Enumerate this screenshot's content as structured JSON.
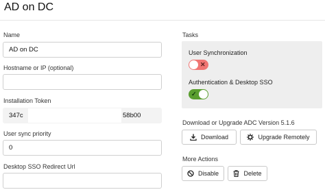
{
  "header": {
    "title": "AD on DC"
  },
  "form": {
    "name": {
      "label": "Name",
      "value": "AD on DC"
    },
    "hostname": {
      "label": "Hostname or IP (optional)",
      "value": ""
    },
    "token": {
      "label": "Installation Token",
      "value_start": "347c",
      "value_end": "58b00"
    },
    "sync_priority": {
      "label": "User sync priority",
      "value": "0"
    },
    "sso_url": {
      "label": "Desktop SSO Redirect Url",
      "value": ""
    }
  },
  "tasks": {
    "label": "Tasks",
    "user_sync": {
      "label": "User Synchronization",
      "enabled": false,
      "mark": "✕"
    },
    "auth_sso": {
      "label": "Authentication & Desktop SSO",
      "enabled": true,
      "mark": "✓"
    }
  },
  "download": {
    "label": "Download or Upgrade ADC Version 5.1.6",
    "download_button": "Download",
    "upgrade_button": "Upgrade Remotely"
  },
  "more_actions": {
    "label": "More Actions",
    "disable_button": "Disable",
    "delete_button": "Delete"
  },
  "colors": {
    "toggle_off": "#f07573",
    "toggle_on": "#5a9e2f",
    "tasks_bg": "#eeeeee"
  },
  "icons": [
    "download-icon",
    "gear-icon",
    "ban-icon",
    "trash-icon",
    "x-icon",
    "check-icon"
  ]
}
